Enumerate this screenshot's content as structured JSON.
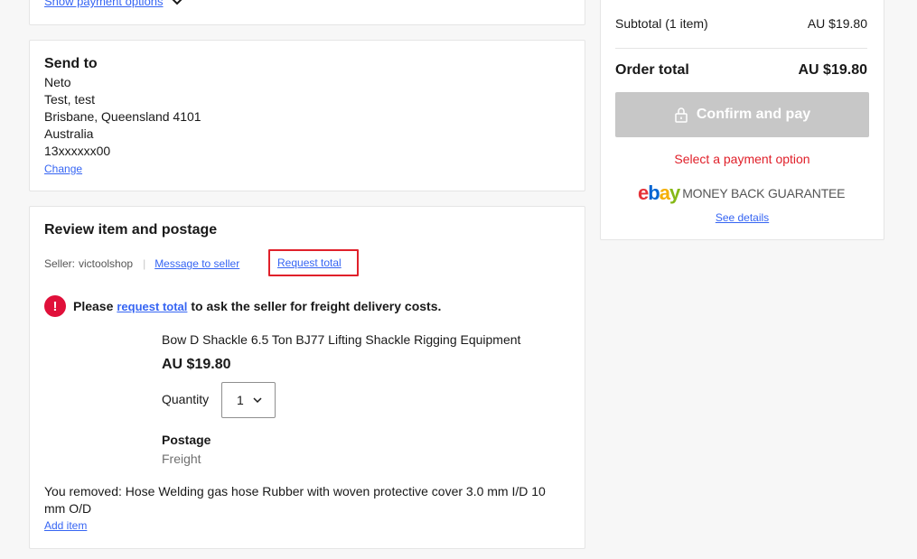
{
  "payment": {
    "show_options_label": "Show payment options"
  },
  "send_to": {
    "title": "Send to",
    "name": "Neto",
    "line1": "Test, test",
    "line2": "Brisbane, Queensland 4101",
    "country": "Australia",
    "phone": "13xxxxxx00",
    "change_label": "Change"
  },
  "review": {
    "title": "Review item and postage",
    "seller_label": "Seller:",
    "seller_name": "victoolshop",
    "message_seller": "Message to seller",
    "request_total": "Request total",
    "alert_prefix": "Please",
    "alert_link": "request total",
    "alert_suffix": "to ask the seller for freight delivery costs.",
    "item_title": "Bow D Shackle 6.5 Ton BJ77 Lifting Shackle Rigging Equipment",
    "item_price": "AU $19.80",
    "quantity_label": "Quantity",
    "quantity_value": "1",
    "postage_label": "Postage",
    "postage_value": "Freight",
    "removed_text": "You removed: Hose Welding gas hose Rubber with woven protective cover 3.0 mm I/D 10 mm O/D",
    "add_item": "Add item"
  },
  "summary": {
    "subtotal_label": "Subtotal (1 item)",
    "subtotal_value": "AU $19.80",
    "total_label": "Order total",
    "total_value": "AU $19.80",
    "confirm_label": "Confirm and pay",
    "select_payment_msg": "Select a payment option",
    "guarantee_text": "MONEY BACK GUARANTEE",
    "see_details": "See details"
  },
  "colors": {
    "link": "#3665f3",
    "error": "#e0202a",
    "disabled_button": "#c7c7c7"
  },
  "icons": [
    "chevron-down-icon",
    "alert-icon",
    "lock-icon",
    "ebay-logo"
  ]
}
